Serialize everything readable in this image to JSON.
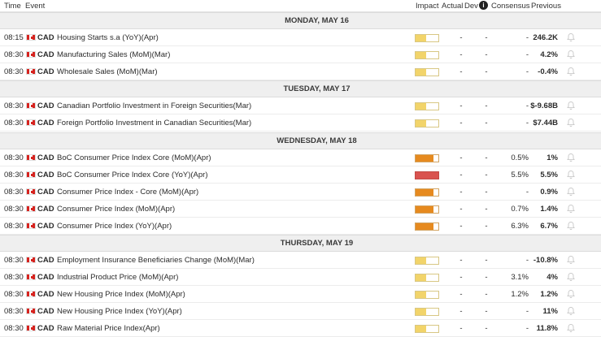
{
  "header": {
    "time": "Time",
    "event": "Event",
    "impact": "Impact",
    "actual": "Actual",
    "dev": "Dev",
    "info": "i",
    "consensus": "Consensus",
    "previous": "Previous"
  },
  "colors": {
    "low_impact": "#f2d46a",
    "medium_impact": "#e68a1f",
    "high_impact": "#d9534f",
    "flag_red": "#d6231f",
    "day_header_bg": "#efefef"
  },
  "days": [
    {
      "label": "MONDAY, MAY 16",
      "events": [
        {
          "time": "08:15",
          "currency": "CAD",
          "name": "Housing Starts s.a (YoY)(Apr)",
          "impact": "low",
          "actual": "-",
          "dev": "-",
          "consensus": "-",
          "previous": "246.2K"
        },
        {
          "time": "08:30",
          "currency": "CAD",
          "name": "Manufacturing Sales (MoM)(Mar)",
          "impact": "low",
          "actual": "-",
          "dev": "-",
          "consensus": "-",
          "previous": "4.2%"
        },
        {
          "time": "08:30",
          "currency": "CAD",
          "name": "Wholesale Sales (MoM)(Mar)",
          "impact": "low",
          "actual": "-",
          "dev": "-",
          "consensus": "-",
          "previous": "-0.4%"
        }
      ]
    },
    {
      "label": "TUESDAY, MAY 17",
      "events": [
        {
          "time": "08:30",
          "currency": "CAD",
          "name": "Canadian Portfolio Investment in Foreign Securities(Mar)",
          "impact": "low",
          "actual": "-",
          "dev": "-",
          "consensus": "-",
          "previous": "$-9.68B"
        },
        {
          "time": "08:30",
          "currency": "CAD",
          "name": "Foreign Portfolio Investment in Canadian Securities(Mar)",
          "impact": "low",
          "actual": "-",
          "dev": "-",
          "consensus": "-",
          "previous": "$7.44B"
        }
      ]
    },
    {
      "label": "WEDNESDAY, MAY 18",
      "events": [
        {
          "time": "08:30",
          "currency": "CAD",
          "name": "BoC Consumer Price Index Core (MoM)(Apr)",
          "impact": "medium",
          "actual": "-",
          "dev": "-",
          "consensus": "0.5%",
          "previous": "1%"
        },
        {
          "time": "08:30",
          "currency": "CAD",
          "name": "BoC Consumer Price Index Core (YoY)(Apr)",
          "impact": "high",
          "actual": "-",
          "dev": "-",
          "consensus": "5.5%",
          "previous": "5.5%"
        },
        {
          "time": "08:30",
          "currency": "CAD",
          "name": "Consumer Price Index - Core (MoM)(Apr)",
          "impact": "medium",
          "actual": "-",
          "dev": "-",
          "consensus": "-",
          "previous": "0.9%"
        },
        {
          "time": "08:30",
          "currency": "CAD",
          "name": "Consumer Price Index (MoM)(Apr)",
          "impact": "medium",
          "actual": "-",
          "dev": "-",
          "consensus": "0.7%",
          "previous": "1.4%"
        },
        {
          "time": "08:30",
          "currency": "CAD",
          "name": "Consumer Price Index (YoY)(Apr)",
          "impact": "medium",
          "actual": "-",
          "dev": "-",
          "consensus": "6.3%",
          "previous": "6.7%"
        }
      ]
    },
    {
      "label": "THURSDAY, MAY 19",
      "events": [
        {
          "time": "08:30",
          "currency": "CAD",
          "name": "Employment Insurance Beneficiaries Change (MoM)(Mar)",
          "impact": "low",
          "actual": "-",
          "dev": "-",
          "consensus": "-",
          "previous": "-10.8%"
        },
        {
          "time": "08:30",
          "currency": "CAD",
          "name": "Industrial Product Price (MoM)(Apr)",
          "impact": "low",
          "actual": "-",
          "dev": "-",
          "consensus": "3.1%",
          "previous": "4%"
        },
        {
          "time": "08:30",
          "currency": "CAD",
          "name": "New Housing Price Index (MoM)(Apr)",
          "impact": "low",
          "actual": "-",
          "dev": "-",
          "consensus": "1.2%",
          "previous": "1.2%"
        },
        {
          "time": "08:30",
          "currency": "CAD",
          "name": "New Housing Price Index (YoY)(Apr)",
          "impact": "low",
          "actual": "-",
          "dev": "-",
          "consensus": "-",
          "previous": "11%"
        },
        {
          "time": "08:30",
          "currency": "CAD",
          "name": "Raw Material Price Index(Apr)",
          "impact": "low",
          "actual": "-",
          "dev": "-",
          "consensus": "-",
          "previous": "11.8%"
        }
      ]
    }
  ]
}
